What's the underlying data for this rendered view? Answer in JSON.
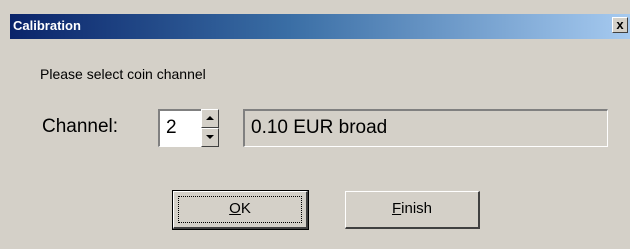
{
  "window": {
    "title": "Calibration",
    "close_glyph": "x"
  },
  "prompt": "Please select coin channel",
  "channel": {
    "label": "Channel:",
    "value": "2",
    "spin_up_icon": "arrow-up-icon",
    "spin_down_icon": "arrow-down-icon"
  },
  "coin": {
    "description": "0.10 EUR broad"
  },
  "buttons": {
    "ok_mnemonic": "O",
    "ok_rest": "K",
    "finish_mnemonic": "F",
    "finish_rest": "inish"
  },
  "colors": {
    "dialog_bg": "#d4d0c8",
    "titlebar_start": "#0a246a",
    "titlebar_end": "#a6caf0"
  }
}
